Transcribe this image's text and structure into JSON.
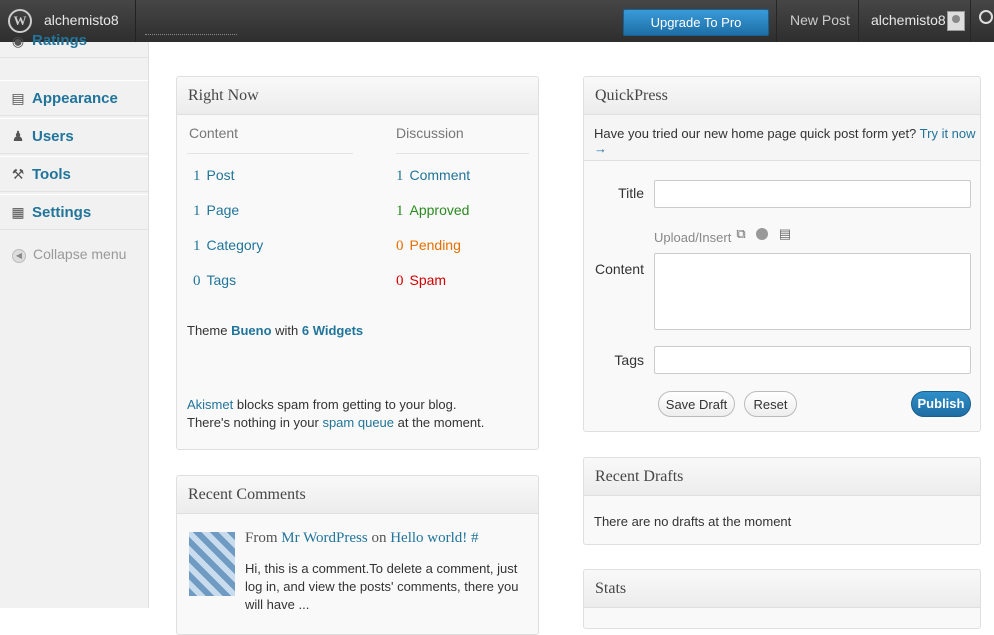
{
  "adminbar": {
    "site_name": "alchemisto8",
    "upgrade_label": "Upgrade To Pro",
    "new_post_label": "New Post",
    "user_name": "alchemisto8",
    "logo_glyph": "W"
  },
  "sidebar": {
    "items": [
      {
        "label": "Ratings",
        "icon": "ratings-icon",
        "glyph": "◉"
      },
      {
        "label": "Appearance",
        "icon": "appearance-icon",
        "glyph": "▤"
      },
      {
        "label": "Users",
        "icon": "users-icon",
        "glyph": "♟"
      },
      {
        "label": "Tools",
        "icon": "tools-icon",
        "glyph": "⚒"
      },
      {
        "label": "Settings",
        "icon": "settings-icon",
        "glyph": "▦"
      }
    ],
    "collapse_label": "Collapse menu",
    "collapse_glyph": "◀"
  },
  "right_now": {
    "title": "Right Now",
    "content_header": "Content",
    "discussion_header": "Discussion",
    "content_rows": [
      {
        "num": "1",
        "label": "Post"
      },
      {
        "num": "1",
        "label": "Page"
      },
      {
        "num": "1",
        "label": "Category"
      },
      {
        "num": "0",
        "label": "Tags"
      }
    ],
    "discussion_rows": [
      {
        "num": "1",
        "label": "Comment"
      },
      {
        "num": "1",
        "label": "Approved"
      },
      {
        "num": "0",
        "label": "Pending"
      },
      {
        "num": "0",
        "label": "Spam"
      }
    ],
    "theme_prefix": "Theme ",
    "theme_name": "Bueno",
    "theme_mid": " with ",
    "widgets": "6 Widgets",
    "akismet_link": "Akismet",
    "akismet_text1": " blocks spam from getting to your blog.",
    "akismet_text2_pre": "There's nothing in your ",
    "spam_queue": "spam queue",
    "akismet_text2_post": " at the moment."
  },
  "recent_comments": {
    "title": "Recent Comments",
    "from_prefix": "From ",
    "author": "Mr WordPress",
    "on": " on ",
    "post": "Hello world! #",
    "excerpt": "Hi, this is a comment.To delete a comment, just log in, and view the posts' comments, there you will have ..."
  },
  "quickpress": {
    "title": "QuickPress",
    "tip": "Have you tried our new home page quick post form yet? ",
    "try_link": "Try it now →",
    "title_label": "Title",
    "content_label": "Content",
    "tags_label": "Tags",
    "upload_label": "Upload/Insert",
    "save_draft": "Save Draft",
    "reset": "Reset",
    "publish": "Publish",
    "title_value": "",
    "content_value": "",
    "tags_value": ""
  },
  "recent_drafts": {
    "title": "Recent Drafts",
    "empty_text": "There are no drafts at the moment"
  },
  "stats": {
    "title": "Stats"
  }
}
